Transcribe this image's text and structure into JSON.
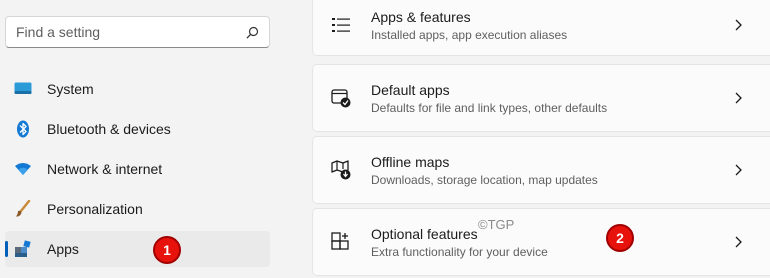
{
  "search": {
    "placeholder": "Find a setting"
  },
  "sidebar": {
    "items": [
      {
        "label": "System",
        "icon": "monitor-icon"
      },
      {
        "label": "Bluetooth & devices",
        "icon": "bluetooth-icon"
      },
      {
        "label": "Network & internet",
        "icon": "wifi-icon"
      },
      {
        "label": "Personalization",
        "icon": "brush-icon"
      },
      {
        "label": "Apps",
        "icon": "apps-icon",
        "selected": true
      }
    ]
  },
  "main": {
    "cards": [
      {
        "title": "Apps & features",
        "subtitle": "Installed apps, app execution aliases",
        "icon": "list-icon"
      },
      {
        "title": "Default apps",
        "subtitle": "Defaults for file and link types, other defaults",
        "icon": "default-apps-icon"
      },
      {
        "title": "Offline maps",
        "subtitle": "Downloads, storage location, map updates",
        "icon": "map-download-icon"
      },
      {
        "title": "Optional features",
        "subtitle": "Extra functionality for your device",
        "icon": "add-grid-icon"
      }
    ]
  },
  "annotations": {
    "badge1": "1",
    "badge2": "2"
  },
  "watermark": "©TGP",
  "colors": {
    "accent": "#005fb8",
    "badge": "#e8120c"
  }
}
